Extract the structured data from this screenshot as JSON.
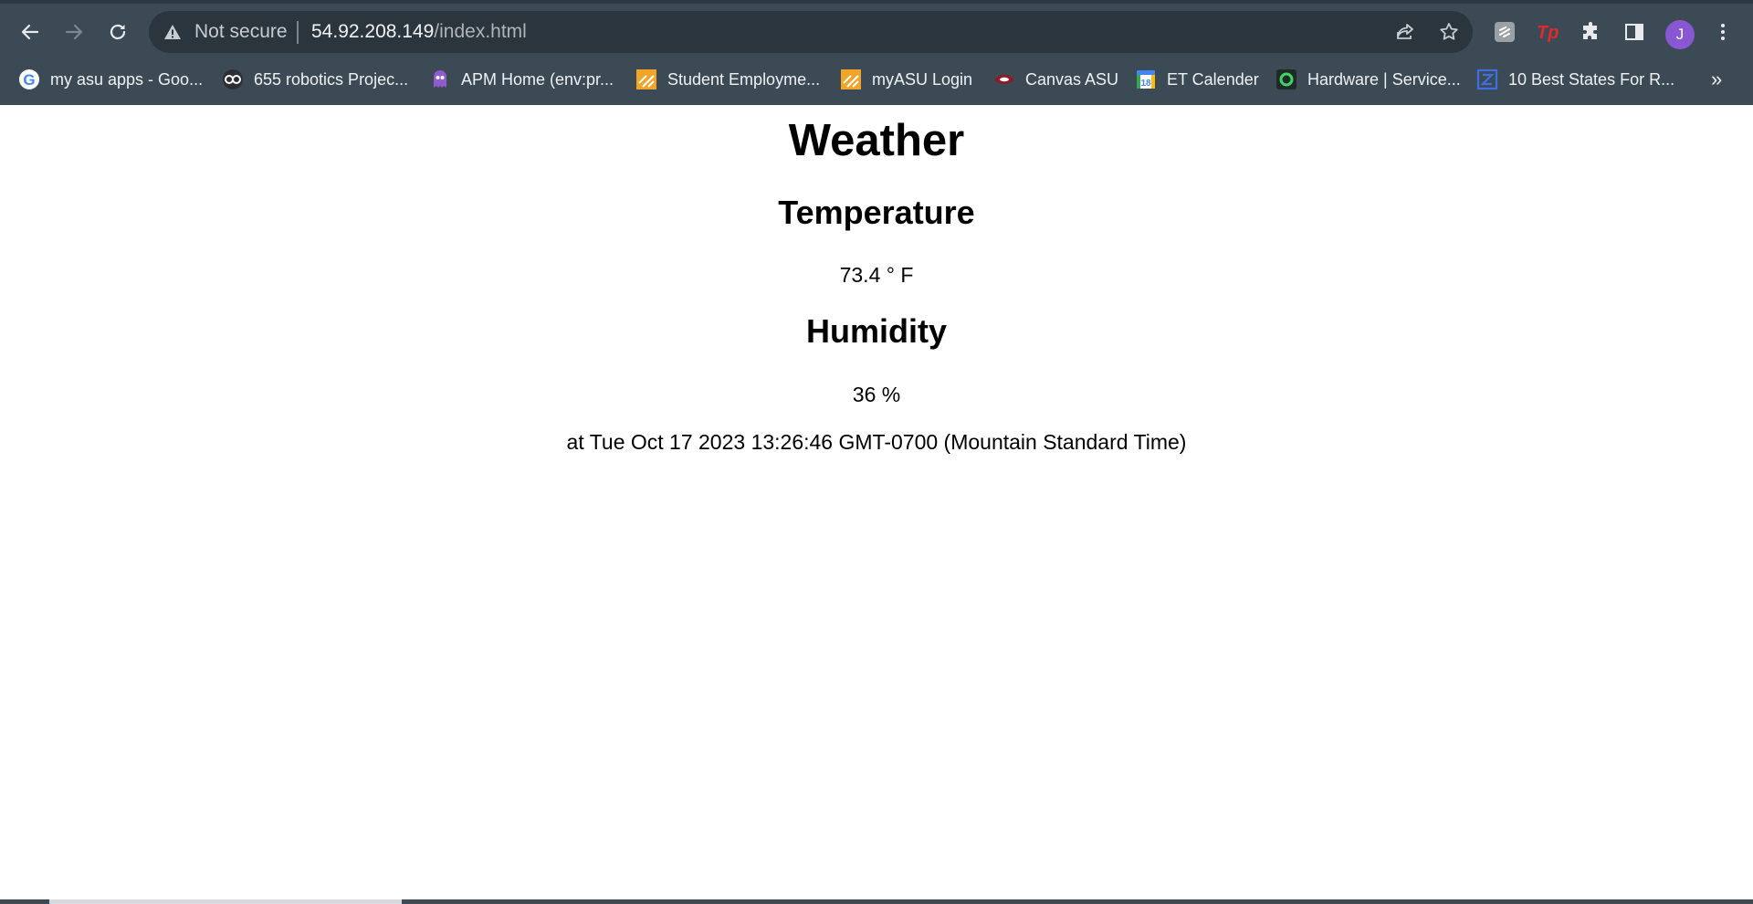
{
  "address_bar": {
    "security_status": "Not secure",
    "url_host": "54.92.208.149",
    "url_path": "/index.html"
  },
  "profile": {
    "initial": "J",
    "color": "#8a57d2"
  },
  "bookmarks": {
    "items": [
      {
        "label": "my asu apps - Goo...",
        "icon": "google-icon"
      },
      {
        "label": "655 robotics Projec...",
        "icon": "goggles-icon"
      },
      {
        "label": "APM Home (env:pr...",
        "icon": "purple-mascot-icon"
      },
      {
        "label": "Student Employme...",
        "icon": "asu-orange-icon"
      },
      {
        "label": "myASU Login",
        "icon": "asu-orange-icon"
      },
      {
        "label": "Canvas ASU",
        "icon": "canvas-icon"
      },
      {
        "label": "ET Calender",
        "icon": "calendar-icon"
      },
      {
        "label": "Hardware | Service...",
        "icon": "hardware-service-icon"
      },
      {
        "label": "10 Best States For R...",
        "icon": "z-logo-icon"
      }
    ],
    "overflow": "»"
  },
  "page": {
    "title": "Weather",
    "temperature_heading": "Temperature",
    "temperature_value": "73.4 ° F",
    "humidity_heading": "Humidity",
    "humidity_value": "36 %",
    "timestamp": "at Tue Oct 17 2023 13:26:46 GMT-0700 (Mountain Standard Time)"
  }
}
